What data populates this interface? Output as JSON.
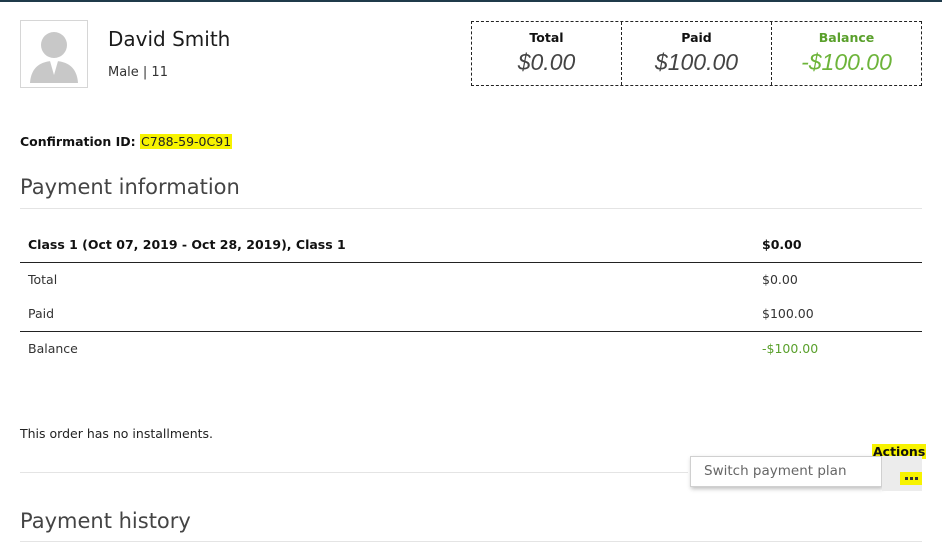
{
  "student": {
    "name": "David Smith",
    "meta": "Male | 11"
  },
  "summary": {
    "total_label": "Total",
    "total_value": "$0.00",
    "paid_label": "Paid",
    "paid_value": "$100.00",
    "balance_label": "Balance",
    "balance_value": "-$100.00"
  },
  "confirmation": {
    "label": "Confirmation ID:",
    "id": "C788-59-0C91"
  },
  "payment_information": {
    "title": "Payment information",
    "header": {
      "label": "Class 1 (Oct 07, 2019 - Oct 28, 2019), Class 1",
      "amount": "$0.00"
    },
    "rows": [
      {
        "label": "Total",
        "amount": "$0.00"
      },
      {
        "label": "Paid",
        "amount": "$100.00"
      },
      {
        "label": "Balance",
        "amount": "-$100.00"
      }
    ],
    "installments_note": "This order has no installments."
  },
  "actions": {
    "label": "Actions",
    "menu_item": "Switch payment plan",
    "more_icon": "ellipsis-icon"
  },
  "payment_history": {
    "title": "Payment history"
  },
  "colors": {
    "balance_green": "#5aa02c",
    "highlight": "#f7f300",
    "top_bar": "#1f3a4a"
  }
}
